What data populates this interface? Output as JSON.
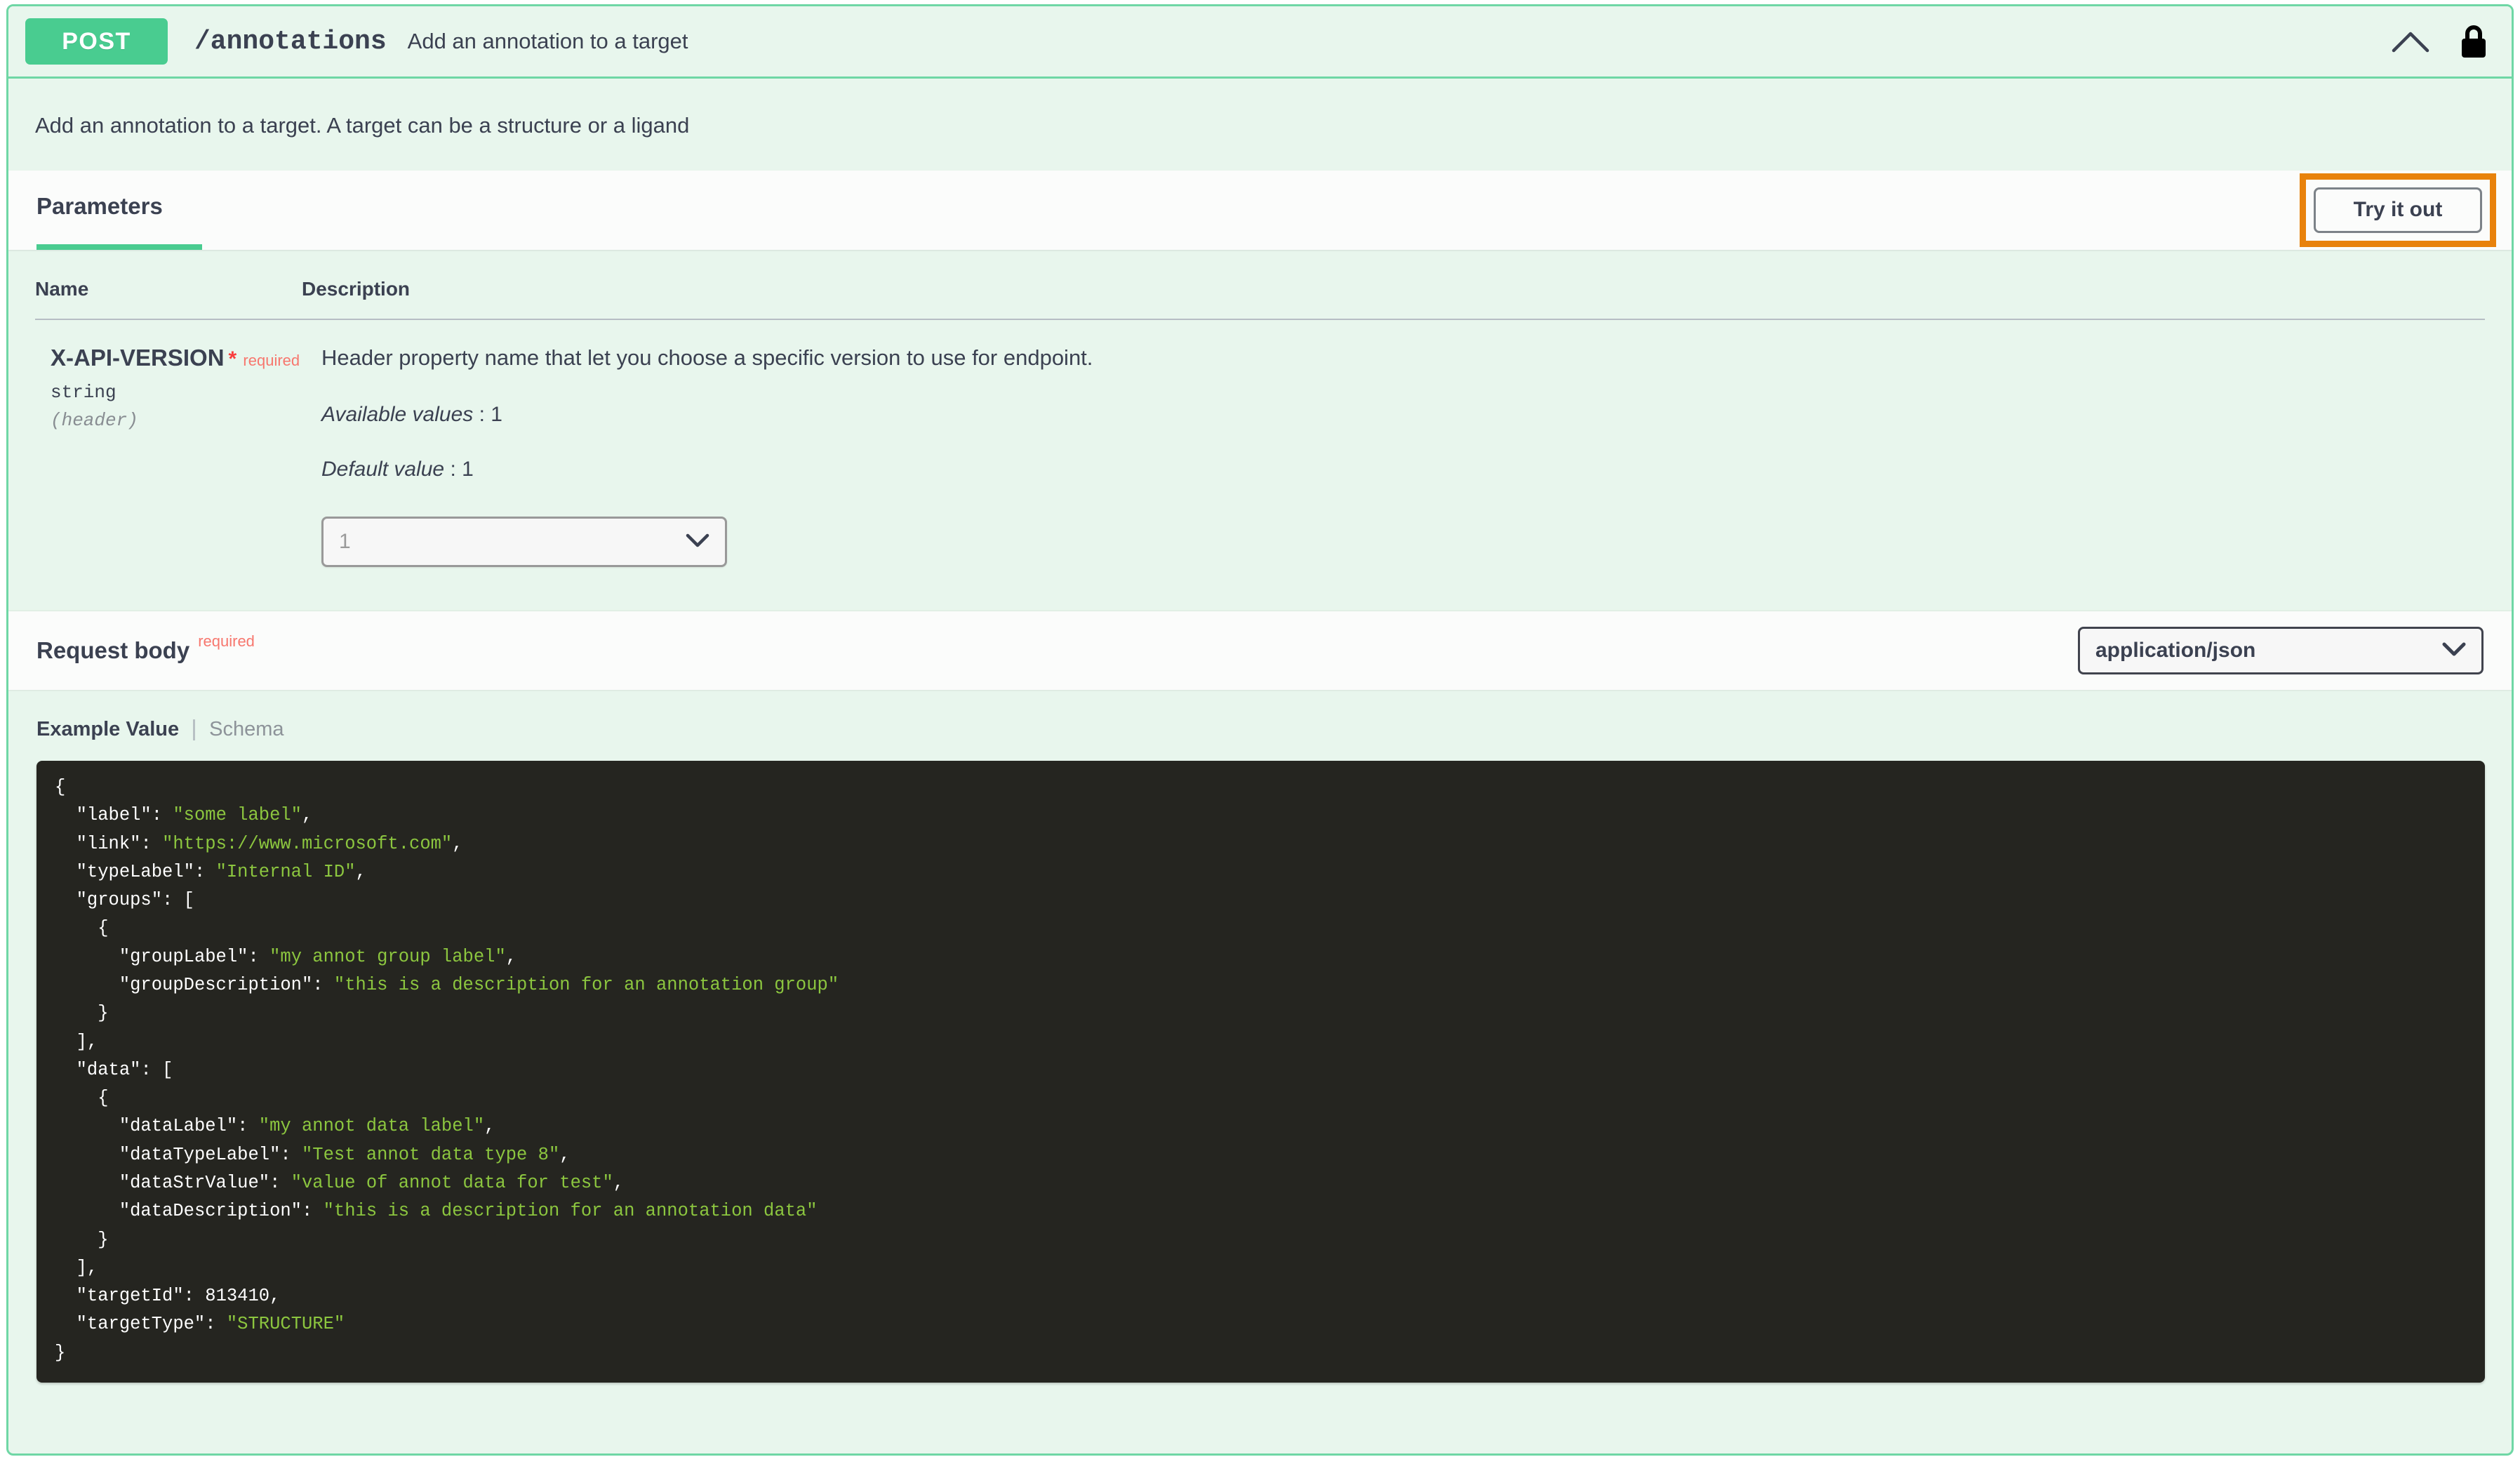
{
  "operation": {
    "method": "POST",
    "path": "/annotations",
    "summary": "Add an annotation to a target",
    "description": "Add an annotation to a target. A target can be a structure or a ligand",
    "collapse_icon": "chevron-up-icon",
    "auth_icon": "lock-icon"
  },
  "colors": {
    "method_badge": "#49cc90",
    "block_border": "#6fd7a5",
    "block_background": "#e8f6ed",
    "tab_accent": "#49cc90",
    "required_text": "#f7776e",
    "required_star": "#f93e3e",
    "highlight_box": "#e8820c",
    "code_background": "#252520",
    "code_string": "#8cc63f"
  },
  "sections": {
    "parameters_tab": "Parameters",
    "try_it_out_label": "Try it out"
  },
  "parameters_table": {
    "headers": [
      "Name",
      "Description"
    ],
    "rows": [
      {
        "name": "X-API-VERSION",
        "required_star": "*",
        "required_label": "required",
        "type": "string",
        "location": "(header)",
        "description": "Header property name that let you choose a specific version to use for endpoint.",
        "available_values_label": "Available values",
        "available_values": "1",
        "default_value_label": "Default value",
        "default_value": "1",
        "select_value": "1"
      }
    ]
  },
  "request_body": {
    "title": "Request body",
    "required_label": "required",
    "content_type": "application/json",
    "tabs": {
      "example_value": "Example Value",
      "schema": "Schema"
    },
    "example_json": {
      "label": "some label",
      "link": "https://www.microsoft.com",
      "typeLabel": "Internal ID",
      "groups": [
        {
          "groupLabel": "my annot group label",
          "groupDescription": "this is a description for an annotation group"
        }
      ],
      "data": [
        {
          "dataLabel": "my annot data label",
          "dataTypeLabel": "Test annot data type 8",
          "dataStrValue": "value of annot data for test",
          "dataDescription": "this is a description for an annotation data"
        }
      ],
      "targetId": 813410,
      "targetType": "STRUCTURE"
    }
  }
}
